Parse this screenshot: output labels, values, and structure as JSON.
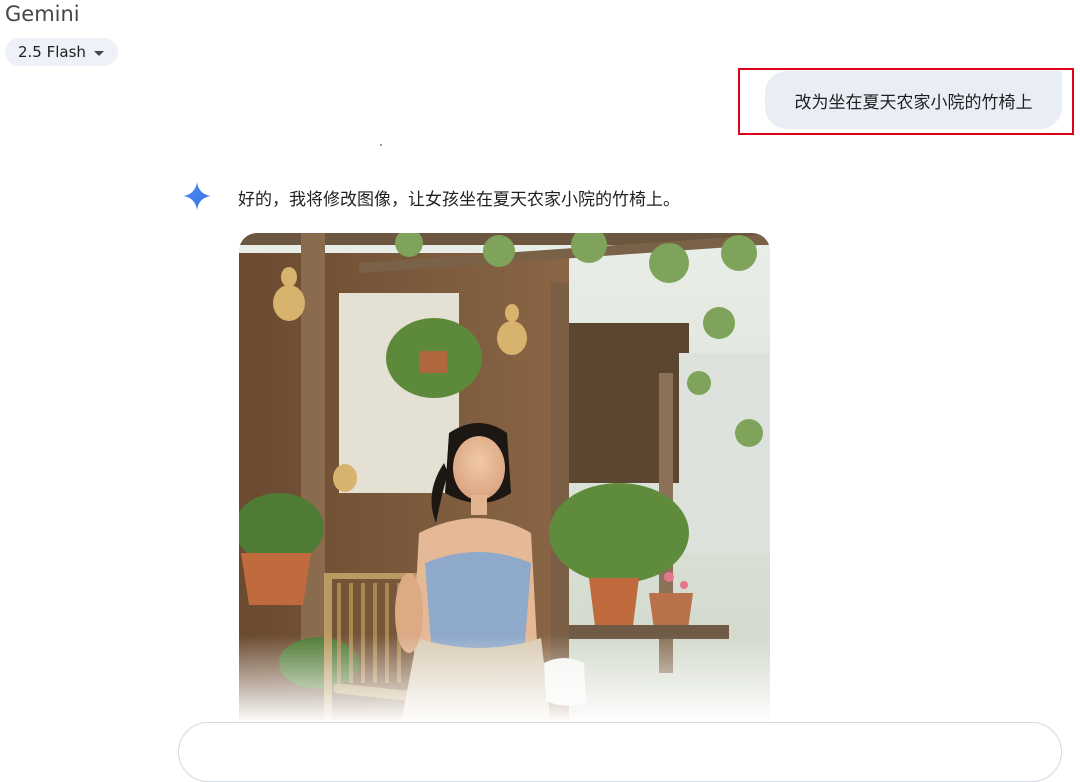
{
  "app": {
    "title": "Gemini"
  },
  "model_selector": {
    "label": "2.5 Flash"
  },
  "conversation": {
    "user_message": "改为坐在夏天农家小院的竹椅上",
    "assistant_message": "好的，我将修改图像，让女孩坐在夏天农家小院的竹椅上。"
  },
  "colors": {
    "accent": "#4285f4",
    "highlight": "#e0001b",
    "user_bubble": "#e9eef6",
    "chip": "#eef1f8"
  },
  "icons": {
    "assistant": "gemini-spark-icon",
    "dropdown": "chevron-down-icon"
  }
}
